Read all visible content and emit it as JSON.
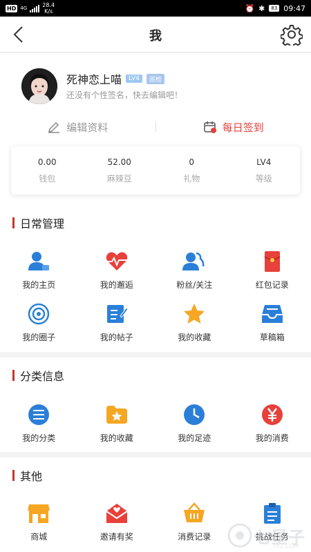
{
  "status_bar": {
    "hd": "HD",
    "network": "4G",
    "speed_value": "28.4",
    "speed_unit": "K/s",
    "battery": "83",
    "time": "09:47"
  },
  "nav": {
    "title": "我",
    "back_icon": "back-icon",
    "settings_icon": "gear-icon"
  },
  "profile": {
    "username": "死神恋上喵",
    "level_badge": "LV4",
    "role_badge": "巡检",
    "signature": "还没有个性签名，快去编辑吧！",
    "edit_label": "编辑资料",
    "sign_label": "每日签到",
    "accent_red": "#e4413a"
  },
  "stats": [
    {
      "value": "0.00",
      "label": "钱包"
    },
    {
      "value": "52.00",
      "label": "麻辣豆"
    },
    {
      "value": "0",
      "label": "礼物"
    },
    {
      "value": "LV4",
      "label": "等级"
    }
  ],
  "sections": {
    "daily": {
      "title": "日常管理",
      "items": [
        {
          "label": "我的主页",
          "icon": "user-home-icon"
        },
        {
          "label": "我的邂逅",
          "icon": "heartbeat-icon"
        },
        {
          "label": "粉丝/关注",
          "icon": "fans-icon"
        },
        {
          "label": "红包记录",
          "icon": "red-envelope-icon"
        },
        {
          "label": "我的圈子",
          "icon": "circle-icon"
        },
        {
          "label": "我的帖子",
          "icon": "post-icon"
        },
        {
          "label": "我的收藏",
          "icon": "star-icon"
        },
        {
          "label": "草稿箱",
          "icon": "draft-box-icon"
        }
      ]
    },
    "category": {
      "title": "分类信息",
      "items": [
        {
          "label": "我的分类",
          "icon": "category-list-icon"
        },
        {
          "label": "我的收藏",
          "icon": "folder-star-icon"
        },
        {
          "label": "我的足迹",
          "icon": "clock-icon"
        },
        {
          "label": "我的消费",
          "icon": "yen-icon"
        }
      ]
    },
    "other": {
      "title": "其他",
      "items": [
        {
          "label": "商城",
          "icon": "shop-icon"
        },
        {
          "label": "邀请有奖",
          "icon": "invite-mail-icon"
        },
        {
          "label": "消费记录",
          "icon": "basket-icon"
        },
        {
          "label": "挑战任务",
          "icon": "clipboard-icon"
        }
      ]
    }
  },
  "watermark": {
    "text": "七星子",
    "sub": "7XZ.COM"
  }
}
